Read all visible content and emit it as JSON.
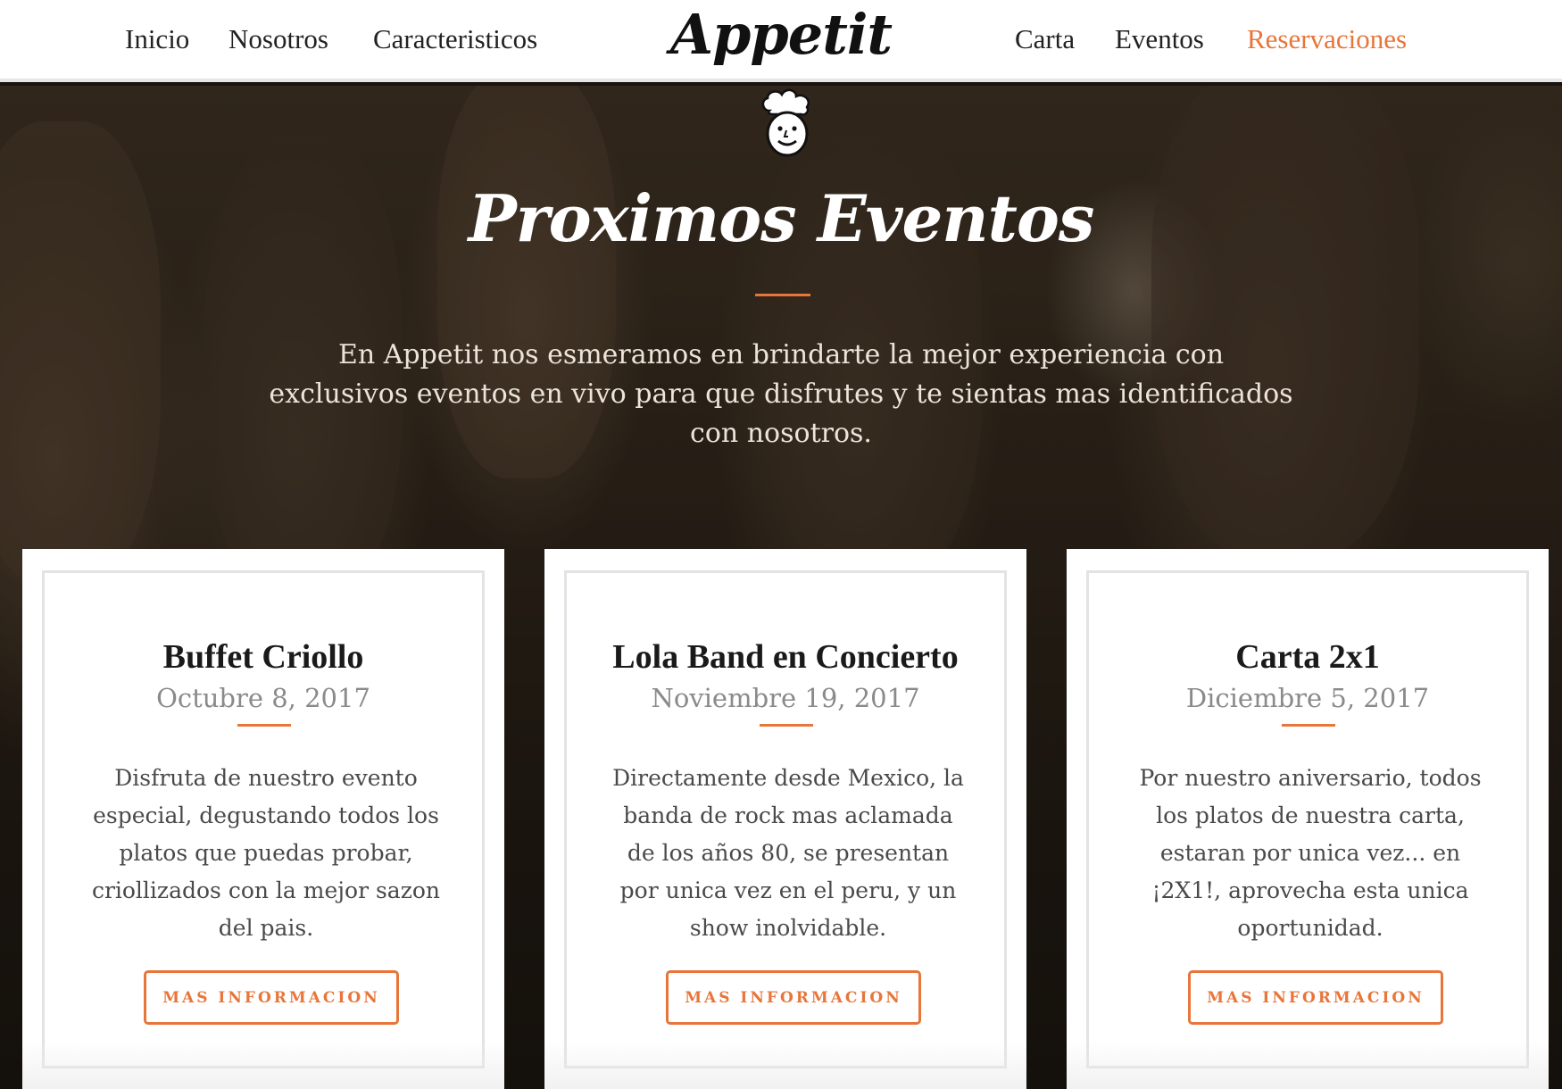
{
  "nav": {
    "left_links": [
      {
        "label": "Inicio"
      },
      {
        "label": "Nosotros"
      },
      {
        "label": "Caracteristicos"
      }
    ],
    "logo": "Appetit",
    "right_links": [
      {
        "label": "Carta"
      },
      {
        "label": "Eventos"
      },
      {
        "label": "Reservaciones",
        "active": true
      }
    ]
  },
  "hero": {
    "icon": "chef-icon",
    "title": "Proximos Eventos",
    "description": "En Appetit nos esmeramos en brindarte la mejor experiencia con exclusivos eventos en vivo para que disfrutes y te sientas mas identificados con nosotros."
  },
  "events": [
    {
      "title": "Buffet Criollo",
      "date": "Octubre 8, 2017",
      "description": "Disfruta de nuestro evento especial, degustando todos los platos que puedas probar, criollizados con la mejor sazon del pais.",
      "button": "MAS INFORMACION"
    },
    {
      "title": "Lola Band en Concierto",
      "date": "Noviembre 19, 2017",
      "description": "Directamente desde Mexico, la banda de rock mas aclamada de los años 80, se presentan por unica vez en el peru, y un show inolvidable.",
      "button": "MAS INFORMACION"
    },
    {
      "title": "Carta 2x1",
      "date": "Diciembre 5, 2017",
      "description": "Por nuestro aniversario, todos los platos de nuestra carta, estaran por unica vez... en ¡2X1!, aprovecha esta unica oportunidad.",
      "button": "MAS INFORMACION"
    }
  ],
  "colors": {
    "accent": "#e8753a",
    "nav_background": "#ffffff",
    "card_background": "#ffffff"
  }
}
